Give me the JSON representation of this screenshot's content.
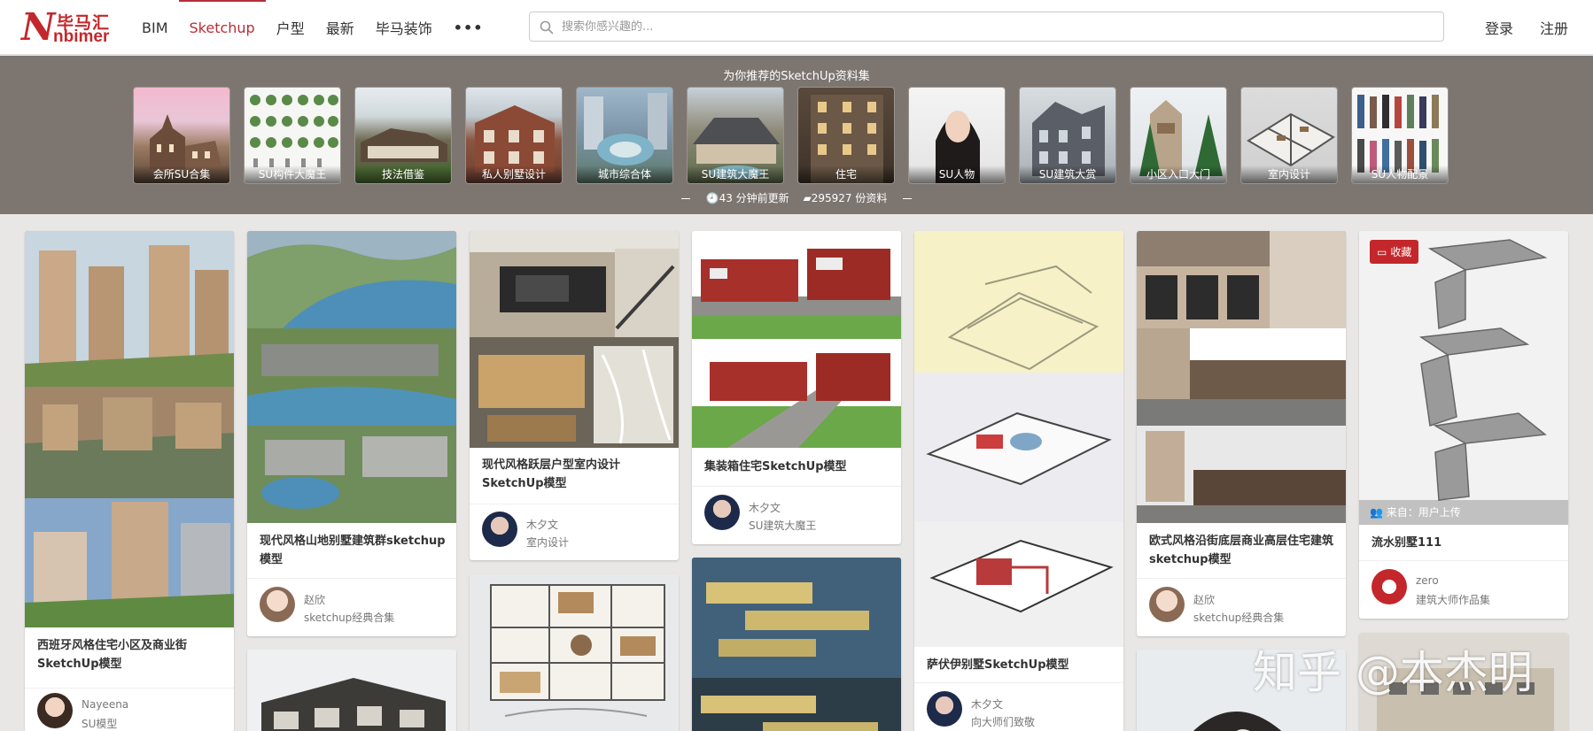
{
  "brand": {
    "logo_letter": "N",
    "logo_cn": "毕马汇",
    "logo_en": "nbimer"
  },
  "nav": {
    "items": [
      {
        "label": "BIM",
        "active": false
      },
      {
        "label": "Sketchup",
        "active": true
      },
      {
        "label": "户型",
        "active": false
      },
      {
        "label": "最新",
        "active": false
      },
      {
        "label": "毕马装饰",
        "active": false
      }
    ],
    "more_label": "•••"
  },
  "search": {
    "placeholder": "搜索你感兴趣的..."
  },
  "auth": {
    "login": "登录",
    "register": "注册"
  },
  "band": {
    "title": "为你推荐的SketchUp资料集",
    "tiles": [
      {
        "label": "会所SU合集"
      },
      {
        "label": "SU构件大魔王"
      },
      {
        "label": "技法借鉴"
      },
      {
        "label": "私人别墅设计"
      },
      {
        "label": "城市综合体"
      },
      {
        "label": "SU建筑大魔王"
      },
      {
        "label": "住宅"
      },
      {
        "label": "SU人物"
      },
      {
        "label": "SU建筑大赏"
      },
      {
        "label": "小区入口大门"
      },
      {
        "label": "室内设计"
      },
      {
        "label": "SU人物配景"
      }
    ],
    "updated": "43 分钟前更新",
    "count": "295927 份资料"
  },
  "cards": [
    {
      "title": "西班牙风格住宅小区及商业街SketchUp模型",
      "user": "Nayeena",
      "category": "SU模型"
    },
    {
      "title": "现代风格山地别墅建筑群sketchup模型",
      "user": "赵欣",
      "category": "sketchup经典合集"
    },
    {
      "title": "现代风格跃层户型室内设计SketchUp模型",
      "user": "木夕文",
      "category": "室内设计"
    },
    {
      "title": "集装箱住宅SketchUp模型",
      "user": "木夕文",
      "category": "SU建筑大魔王"
    },
    {
      "title": "萨伏伊别墅SketchUp模型",
      "user": "木夕文",
      "category": "向大师们致敬"
    },
    {
      "title": "欧式风格沿街底层商业高层住宅建筑sketchup模型",
      "user": "赵欣",
      "category": "sketchup经典合集"
    },
    {
      "title": "流水别墅111",
      "user": "zero",
      "category": "建筑大师作品集",
      "fav_label": "收藏",
      "source": "来自：用户上传"
    }
  ],
  "watermark": "知乎 @本杰明",
  "colors": {
    "brand_red": "#c3272b",
    "band_bg": "#7c7570",
    "page_bg": "#e9e7e5"
  }
}
